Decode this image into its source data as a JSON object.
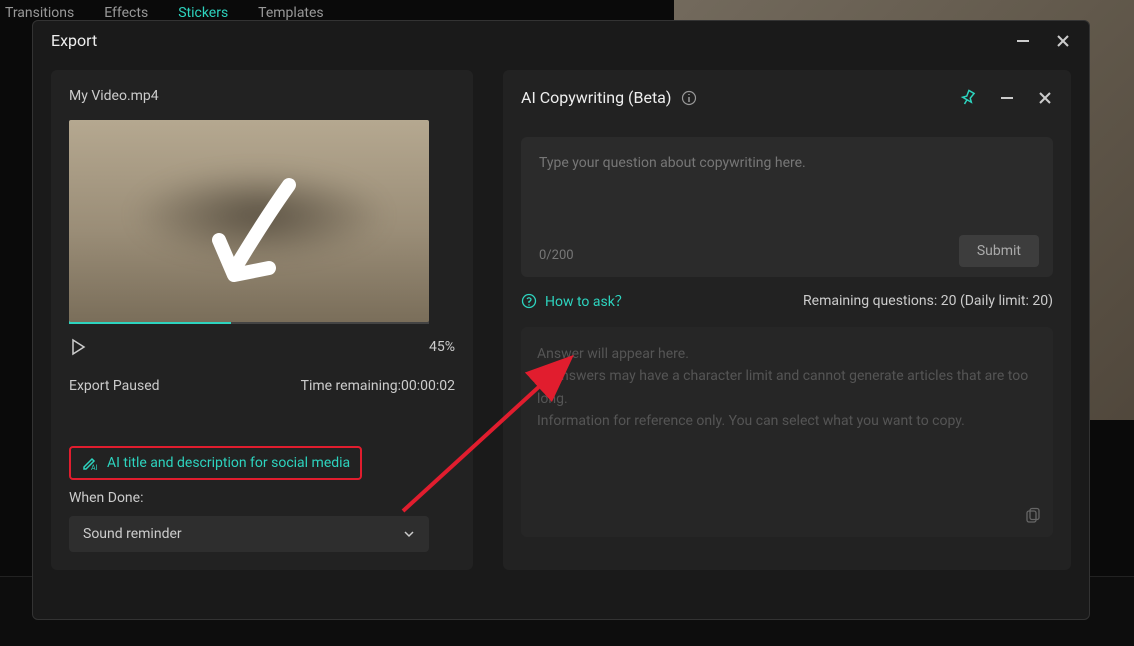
{
  "bg": {
    "tabs": [
      "Transitions",
      "Effects",
      "Stickers",
      "Templates"
    ]
  },
  "export": {
    "title": "Export",
    "filename": "My Video.mp4",
    "progress_percent": "45%",
    "status": "Export Paused",
    "time_remaining_label": "Time remaining:",
    "time_remaining_val": "00:00:02",
    "ai_title_link": "AI title and description for social media",
    "when_done_label": "When Done:",
    "dropdown_value": "Sound reminder"
  },
  "ai": {
    "title": "AI Copywriting (Beta)",
    "placeholder": "Type your question about copywriting here.",
    "char_count": "0/200",
    "submit": "Submit",
    "how_to_ask": "How to ask？",
    "remaining_label": "Remaining questions: ",
    "remaining_count": "20",
    "daily_limit_label": " (Daily limit: ",
    "daily_limit_val": "20",
    "daily_limit_close": ")",
    "answer_placeholder_1": "Answer will appear here.",
    "answer_placeholder_2": "AI answers may have a character limit and cannot generate articles that are too long.",
    "answer_placeholder_3": "Information for reference only. You can select what you want to copy."
  }
}
